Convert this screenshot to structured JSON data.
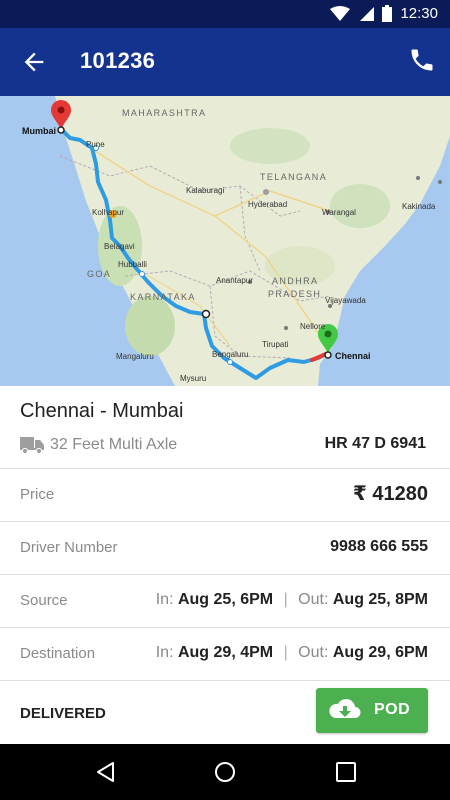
{
  "status_bar": {
    "time": "12:30"
  },
  "app_bar": {
    "title": "101236"
  },
  "map": {
    "region_labels": [
      "MAHARASHTRA",
      "TELANGANA",
      "GOA",
      "KARNATAKA",
      "ANDHRA",
      "PRADESH"
    ],
    "city_labels": [
      "Pune",
      "Kolhapur",
      "Belagavi",
      "Hubballi",
      "Kalaburagi",
      "Hyderabad",
      "Warangal",
      "Vijayawada",
      "Kakinada",
      "Nellore",
      "Anantapur",
      "Tirupati",
      "Mangaluru",
      "Bengaluru",
      "Mysuru"
    ],
    "origin": "Mumbai",
    "destination": "Chennai"
  },
  "trip": {
    "route": "Chennai - Mumbai",
    "vehicle_type": "32 Feet Multi Axle",
    "vehicle_number": "HR 47 D 6941"
  },
  "details": {
    "price_label": "Price",
    "price_value": "₹ 41280",
    "driver_label": "Driver Number",
    "driver_value": "9988 666 555",
    "source_label": "Source",
    "source_in_key": "In:",
    "source_in_value": "Aug 25, 6PM",
    "source_out_key": "Out:",
    "source_out_value": "Aug 25, 8PM",
    "destination_label": "Destination",
    "dest_in_key": "In:",
    "dest_in_value": "Aug 29, 4PM",
    "dest_out_key": "Out:",
    "dest_out_value": "Aug 29, 6PM",
    "separator": "|"
  },
  "footer": {
    "status": "DELIVERED",
    "pod_label": "POD"
  },
  "colors": {
    "app_bar": "#14338f",
    "status_bar": "#0b1b58",
    "route": "#2f9be3",
    "pod": "#4caf50",
    "origin_pin": "#e53935",
    "destination_pin": "#43c943"
  },
  "icons": [
    "back-arrow-icon",
    "phone-icon",
    "truck-icon",
    "cloud-download-icon",
    "nav-back-icon",
    "nav-home-icon",
    "nav-recents-icon",
    "wifi-icon",
    "signal-icon",
    "battery-icon"
  ]
}
